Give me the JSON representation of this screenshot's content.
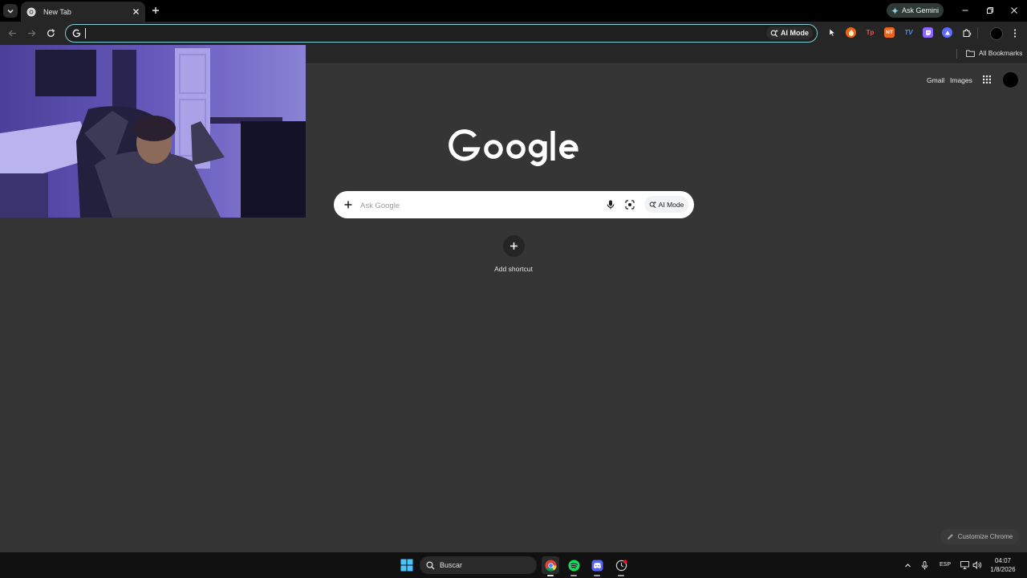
{
  "browser": {
    "tab": {
      "title": "New Tab"
    },
    "gemini_button": "Ask Gemini",
    "omnibox": {
      "value": "",
      "ai_mode_label": "AI Mode"
    },
    "extensions": [
      {
        "name": "cursor-extension-icon",
        "color": "#2a2a2a"
      },
      {
        "name": "fire-extension-icon",
        "color": "#e8651c"
      },
      {
        "name": "tp-extension-icon",
        "color": "#d23434"
      },
      {
        "name": "nt-extension-icon",
        "color": "#e8651c"
      },
      {
        "name": "tv-extension-icon",
        "color": "#2f6de1"
      },
      {
        "name": "twitch-extension-icon",
        "color": "#8d65ff"
      },
      {
        "name": "vpn-extension-icon",
        "color": "#5b6cff"
      }
    ],
    "bookmarks": {
      "all_label": "All Bookmarks"
    }
  },
  "page": {
    "links": {
      "gmail": "Gmail",
      "images": "Images"
    },
    "search": {
      "placeholder": "Ask Google",
      "ai_mode_label": "AI Mode"
    },
    "shortcut_label": "Add shortcut",
    "customize_label": "Customize Chrome"
  },
  "taskbar": {
    "search_label": "Buscar",
    "language": "ESP",
    "time": "04:07",
    "date": "1/8/2026"
  },
  "colors": {
    "accent_omnibox": "#7fcfd9",
    "page_bg": "#353535",
    "toolbar_bg": "#262626"
  }
}
